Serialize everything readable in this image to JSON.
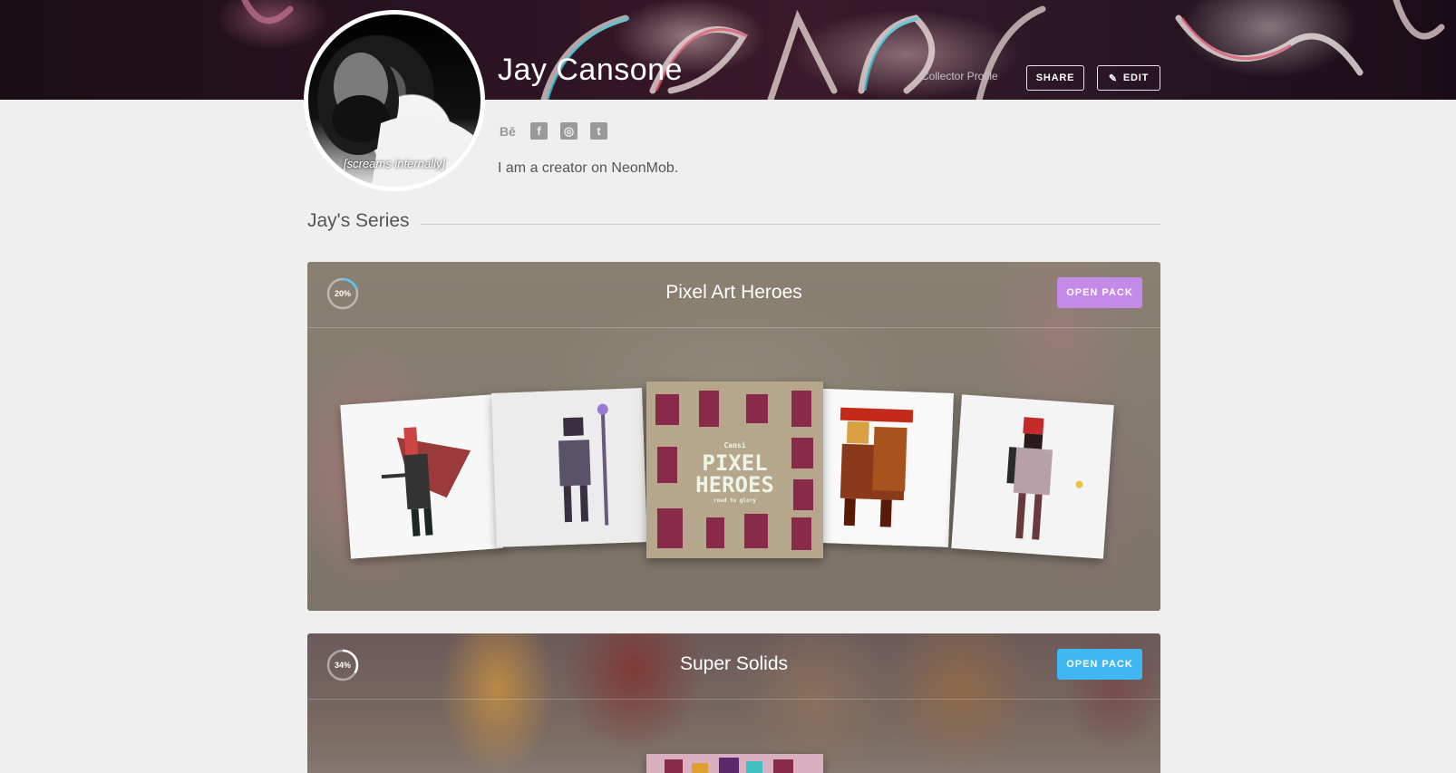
{
  "profile": {
    "name": "Jay Cansone",
    "type_label": "Collector Profile",
    "avatar_caption": "[screams internally]",
    "bio": "I am a creator on NeonMob.",
    "share_label": "SHARE",
    "edit_label": "EDIT",
    "socials": [
      {
        "name": "behance",
        "glyph": "Bē"
      },
      {
        "name": "facebook",
        "glyph": "f"
      },
      {
        "name": "instagram",
        "glyph": "◎"
      },
      {
        "name": "tumblr",
        "glyph": "t"
      }
    ]
  },
  "section": {
    "title": "Jay's Series"
  },
  "series": [
    {
      "title": "Pixel Art Heroes",
      "progress_label": "20%",
      "progress": 0.2,
      "button_label": "OPEN PACK",
      "button_color": "#c38ae8",
      "pack_logo": {
        "line1": "Cansi",
        "line2": "PIXEL",
        "line3": "HEROES",
        "line4": "road to glory"
      }
    },
    {
      "title": "Super Solids",
      "progress_label": "34%",
      "progress": 0.34,
      "button_label": "OPEN PACK",
      "button_color": "#41b7f1"
    }
  ],
  "colors": {
    "page_bg": "#efefef",
    "open_pack_purple": "#c38ae8",
    "open_pack_blue": "#41b7f1"
  }
}
